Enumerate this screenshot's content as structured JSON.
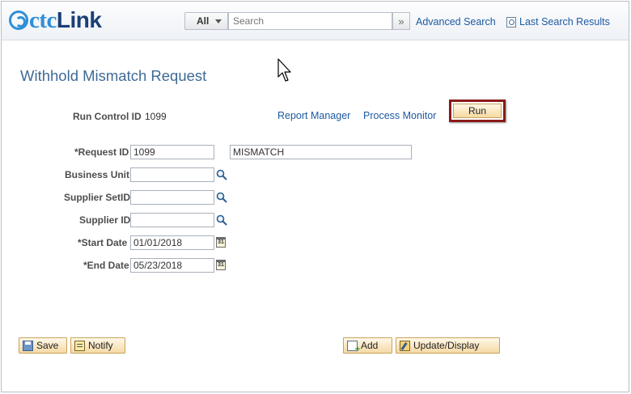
{
  "header": {
    "logo_ctc": "ctc",
    "logo_link": "Link",
    "search_scope": "All",
    "search_placeholder": "Search",
    "advanced_search": "Advanced Search",
    "last_search_results": "Last Search Results"
  },
  "page": {
    "title": "Withhold Mismatch Request"
  },
  "run_control": {
    "label": "Run Control ID",
    "value": "1099",
    "report_manager": "Report Manager",
    "process_monitor": "Process Monitor",
    "run_button": "Run"
  },
  "form": {
    "request_id": {
      "label": "*Request ID",
      "value": "1099",
      "description": "MISMATCH"
    },
    "business_unit": {
      "label": "Business Unit",
      "value": ""
    },
    "supplier_setid": {
      "label": "Supplier SetID",
      "value": ""
    },
    "supplier_id": {
      "label": "Supplier ID",
      "value": ""
    },
    "start_date": {
      "label": "*Start Date",
      "value": "01/01/2018"
    },
    "end_date": {
      "label": "*End Date",
      "value": "05/23/2018"
    }
  },
  "toolbar": {
    "save": "Save",
    "notify": "Notify",
    "add": "Add",
    "update_display": "Update/Display"
  },
  "calendar_icon_text": "31"
}
